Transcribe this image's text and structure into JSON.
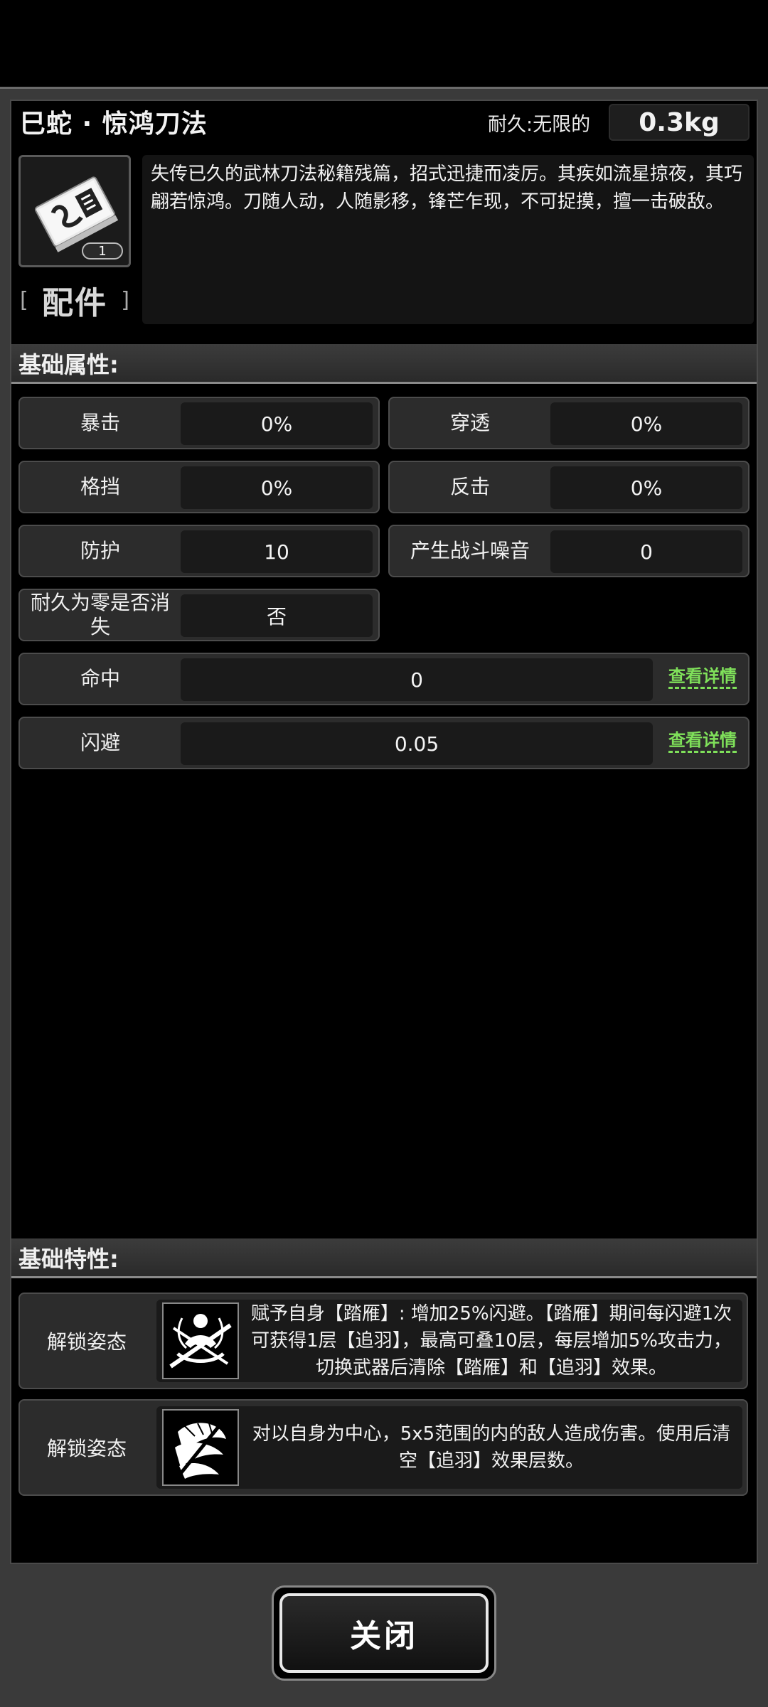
{
  "header": {
    "title": "巳蛇 · 惊鸿刀法",
    "durability_label": "耐久:无限的",
    "weight": "0.3kg"
  },
  "item": {
    "icon": "manual-book-icon",
    "count": "1",
    "type_open": "[",
    "type_text": "配件",
    "type_close": "]",
    "description": "失传已久的武林刀法秘籍残篇，招式迅捷而凌厉。其疾如流星掠夜，其巧翩若惊鸿。刀随人动，人随影移，锋芒乍现，不可捉摸，擅一击破敌。"
  },
  "basic_attributes": {
    "title": "基础属性:",
    "stats": [
      {
        "label": "暴击",
        "value": "0%"
      },
      {
        "label": "穿透",
        "value": "0%"
      },
      {
        "label": "格挡",
        "value": "0%"
      },
      {
        "label": "反击",
        "value": "0%"
      },
      {
        "label": "防护",
        "value": "10"
      },
      {
        "label": "产生战斗噪音",
        "value": "0"
      },
      {
        "label": "耐久为零是否消失",
        "value": "否"
      }
    ],
    "wide_stats": [
      {
        "label": "命中",
        "value": "0",
        "link": "查看详情"
      },
      {
        "label": "闪避",
        "value": "0.05",
        "link": "查看详情"
      }
    ]
  },
  "basic_traits": {
    "title": "基础特性:",
    "traits": [
      {
        "label": "解锁姿态",
        "icon": "stance-figure-icon",
        "text": "赋予自身【踏雁】: 增加25%闪避。【踏雁】期间每闪避1次可获得1层【追羽】，最高可叠10层，每层增加5%攻击力，切换武器后清除【踏雁】和【追羽】效果。"
      },
      {
        "label": "解锁姿态",
        "icon": "feather-slash-icon",
        "text": "对以自身为中心，5x5范围的内的敌人造成伤害。使用后清空【追羽】效果层数。"
      }
    ]
  },
  "footer": {
    "close_label": "关闭"
  }
}
